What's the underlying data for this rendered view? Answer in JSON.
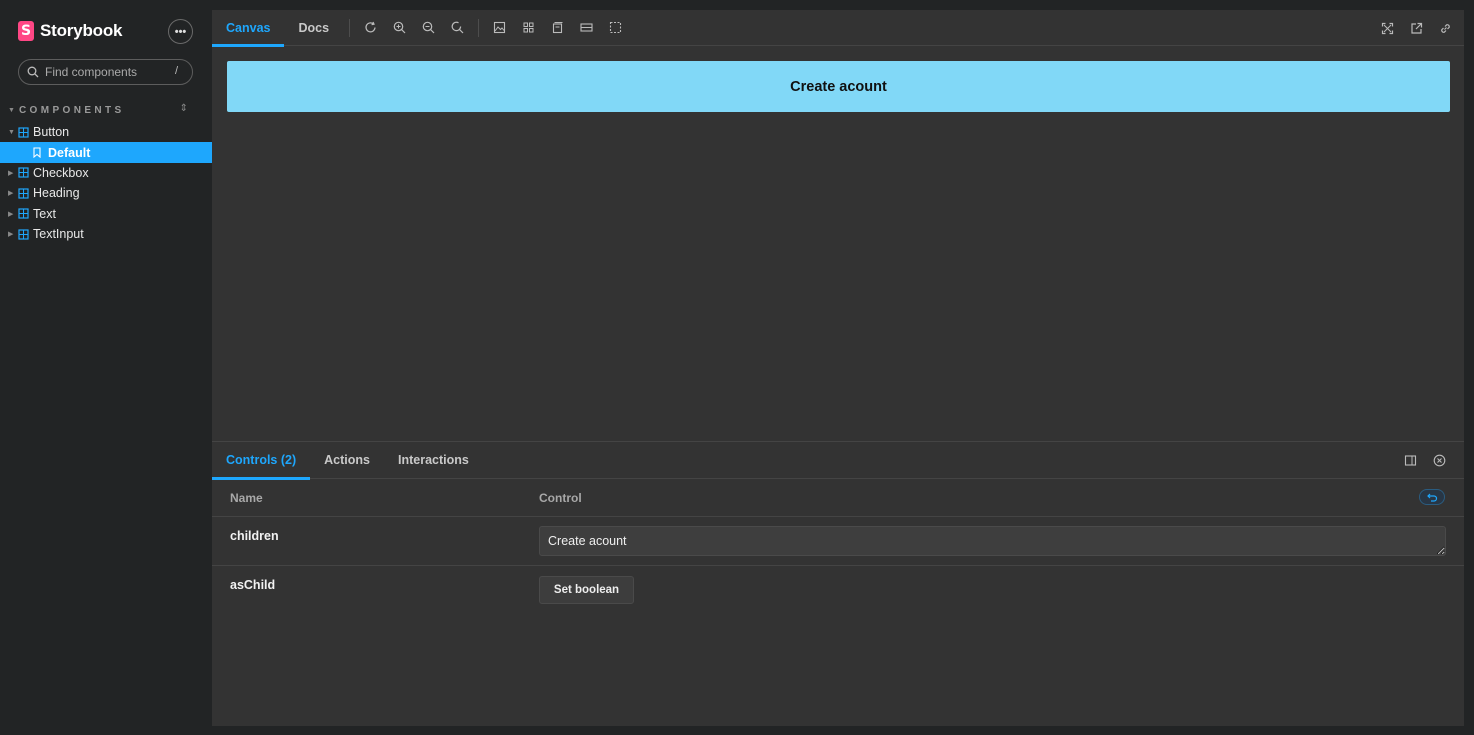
{
  "brand": {
    "logo_letter": "S",
    "name": "Storybook",
    "menu_label": "•••"
  },
  "search": {
    "placeholder": "Find components",
    "shortcut": "/"
  },
  "sidebar": {
    "section_label": "COMPONENTS",
    "items": [
      {
        "label": "Button",
        "expanded": true
      },
      {
        "label": "Default",
        "selected": true,
        "child": true
      },
      {
        "label": "Checkbox"
      },
      {
        "label": "Heading"
      },
      {
        "label": "Text"
      },
      {
        "label": "TextInput"
      }
    ]
  },
  "toolbar": {
    "tabs": [
      {
        "label": "Canvas",
        "active": true
      },
      {
        "label": "Docs"
      }
    ],
    "tools": [
      "reload-icon",
      "zoom-in-icon",
      "zoom-out-icon",
      "zoom-reset-icon",
      "background-icon",
      "grid-icon",
      "viewport-icon",
      "measure-icon",
      "outline-icon"
    ],
    "right_tools": [
      "fullscreen-icon",
      "open-new-tab-icon",
      "copy-link-icon"
    ]
  },
  "canvas": {
    "button_label": "Create acount",
    "button_color": "#81d8f7"
  },
  "panel": {
    "tabs": [
      {
        "label": "Controls (2)",
        "active": true
      },
      {
        "label": "Actions"
      },
      {
        "label": "Interactions"
      }
    ],
    "table": {
      "headers": {
        "name": "Name",
        "control": "Control"
      },
      "rows": [
        {
          "name": "children",
          "value": "Create acount"
        },
        {
          "name": "asChild",
          "button_label": "Set boolean"
        }
      ]
    }
  },
  "colors": {
    "accent": "#1ea7fd",
    "brand": "#ff4785",
    "sidebar_bg": "#222425",
    "main_bg": "#333333"
  }
}
